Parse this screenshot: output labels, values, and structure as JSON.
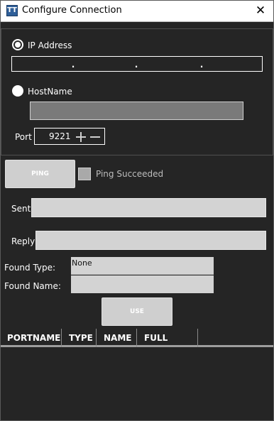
{
  "window": {
    "title": "Configure Connection",
    "close_glyph": "✕",
    "app_icon_glyph": "TT"
  },
  "connection": {
    "ip_option_label": "IP Address",
    "ip_selected": true,
    "ip_separators": [
      ".",
      ".",
      "."
    ],
    "host_option_label": "HostName",
    "host_value": "",
    "port_label": "Port",
    "port_value": "9221"
  },
  "ping": {
    "button_label": "PING",
    "status_label": "Ping Succeeded",
    "status_checked": false
  },
  "sent": {
    "label": "Sent",
    "value": ""
  },
  "reply": {
    "label": "Reply",
    "value": ""
  },
  "found": {
    "type_label": "Found Type:",
    "type_value": "None",
    "name_label": "Found Name:",
    "name_value": ""
  },
  "use_button_label": "USE",
  "grid": {
    "columns": [
      "PORTNAME",
      "TYPE",
      "NAME",
      "FULL NAME"
    ]
  },
  "colors": {
    "background": "#252525",
    "field": "#d3d3d3",
    "host_field": "#7a7a7a",
    "button": "#cfcfcf"
  }
}
